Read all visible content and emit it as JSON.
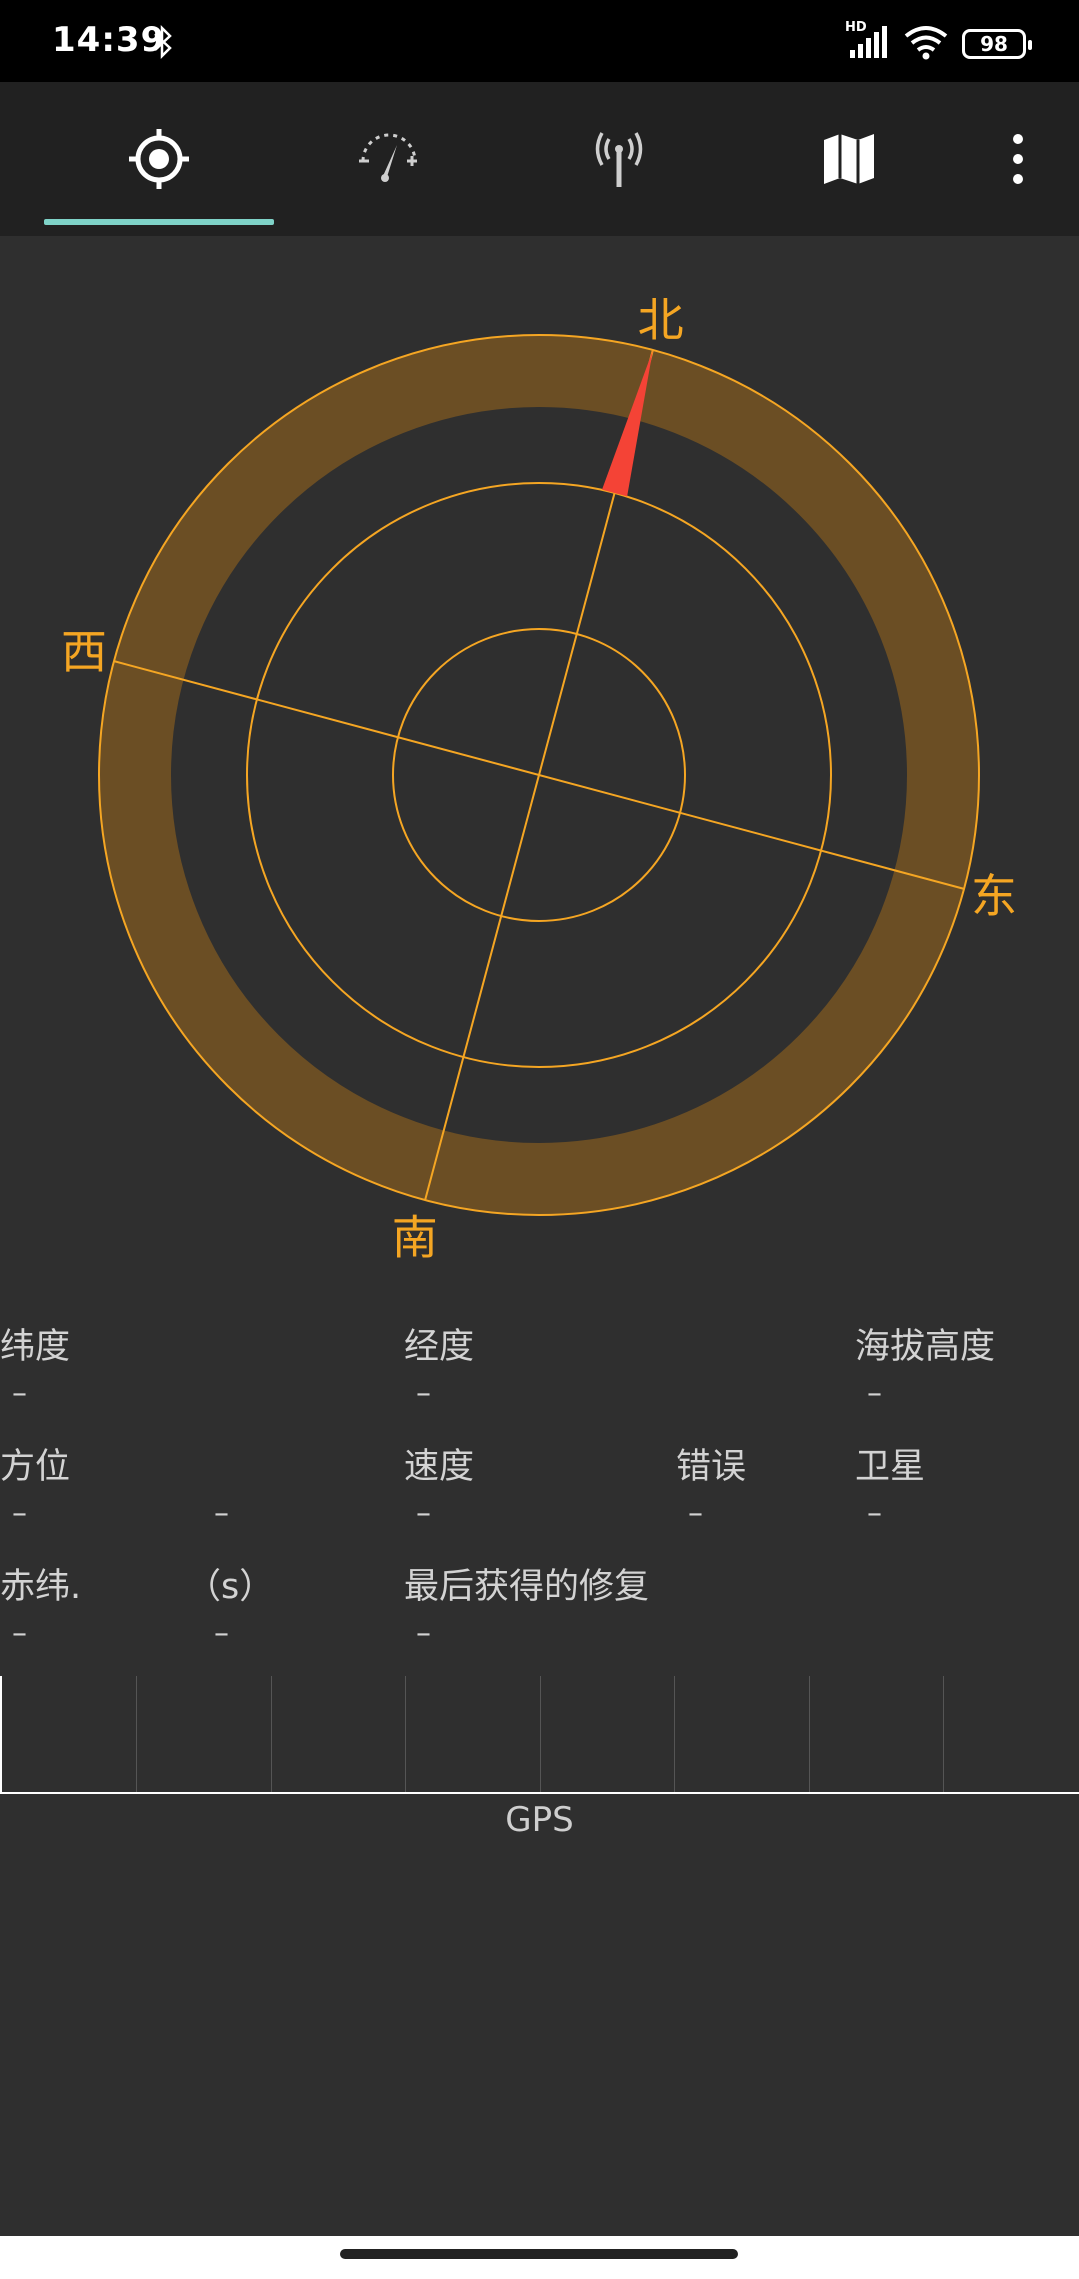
{
  "status_bar": {
    "time": "14:39",
    "hd": "HD",
    "battery": "98",
    "icons": [
      "bluetooth-icon",
      "signal-icon",
      "wifi-icon",
      "battery-icon"
    ]
  },
  "toolbar": {
    "tabs": [
      {
        "name": "tab-location",
        "icon": "crosshair-icon",
        "active": true
      },
      {
        "name": "tab-speed",
        "icon": "speedometer-icon",
        "active": false
      },
      {
        "name": "tab-signal",
        "icon": "antenna-icon",
        "active": false
      },
      {
        "name": "tab-map",
        "icon": "map-icon",
        "active": false
      }
    ],
    "menu_icon": "more-vert-icon",
    "indicator_color": "#7fd3c8"
  },
  "compass": {
    "north": "北",
    "south": "南",
    "east": "东",
    "west": "西",
    "heading_deg": 15,
    "ring_color": "#f5a623",
    "needle_color": "#f44336"
  },
  "info": {
    "row1": {
      "latitude_label": "纬度",
      "latitude_value": "–",
      "longitude_label": "经度",
      "longitude_value": "–",
      "altitude_label": "海拔高度",
      "altitude_value": "–"
    },
    "row2": {
      "bearing_label": "方位",
      "bearing_value": "–",
      "bearing_value2": "–",
      "speed_label": "速度",
      "speed_value": "–",
      "error_label": "错误",
      "error_value": "–",
      "satellites_label": "卫星",
      "satellites_value": "–"
    },
    "row3": {
      "declination_label": "赤纬.",
      "declination_value": "–",
      "seconds_label": "（s）",
      "seconds_value": "–",
      "last_fix_label": "最后获得的修复",
      "last_fix_value": "–"
    }
  },
  "graph": {
    "label": "GPS"
  }
}
